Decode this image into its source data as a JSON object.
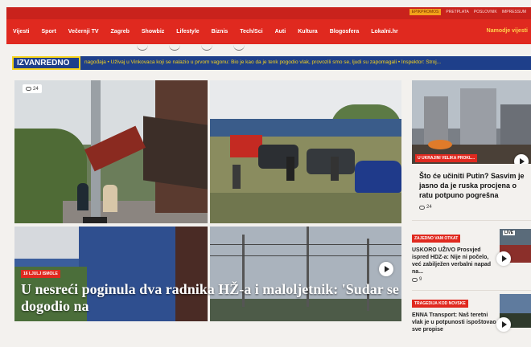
{
  "header": {
    "top_links": [
      "EPIKPROMOS",
      "PRETPLATA",
      "POSLOVNIK",
      "IMPRESSUM"
    ],
    "nav_items": [
      "Vijesti",
      "Sport",
      "Večernji TV",
      "Zagreb",
      "Showbiz",
      "Lifestyle",
      "Biznis",
      "Tech/Sci",
      "Auti",
      "Kultura",
      "Blogosfera",
      "Lokalni.hr"
    ],
    "cta": "Namodje vijesti"
  },
  "breaking": {
    "label": "IZVANREDNO",
    "ticker": "nagođaja  •  Uživaj u Vinkovaca koji se nalazio u prvom vagonu: Bio je kao da je tenk pogodio vlak, provozili smo se, ljudi su zapomagali  •  Inspektor: Stroj..."
  },
  "lead": {
    "comments": "24",
    "tag": "16 LJULJ ISMOLE",
    "title": "U nesreći poginula dva radnika HŽ-a i maloljetnik: 'Sudar se dogodio na"
  },
  "sidebar": {
    "main_tag": "U UKRAJINI VELIKA PROKL...",
    "main_title": "Što će učiniti Putin? Sasvim je jasno da je ruska procjena o ratu potpuno pogrešna",
    "main_comments": "24",
    "stories": [
      {
        "tag": "ZAJEDNO VAM OTKAT",
        "title": "USKORO UŽIVO Prosvjed ispred HDZ-a: Nije ni počelo, već zabilježen verbalni napad na...",
        "comments": "9",
        "live": "LIVE"
      },
      {
        "tag": "TRAGEDIJA KOD NOVSKE",
        "title": "ENNA Transport: Naš teretni vlak je u potpunosti ispoštovao sve propise",
        "comments": ""
      }
    ]
  },
  "colors": {
    "brand_red": "#e0291f",
    "breaking_blue": "#1e3f8a",
    "breaking_yellow": "#f5d21c"
  }
}
